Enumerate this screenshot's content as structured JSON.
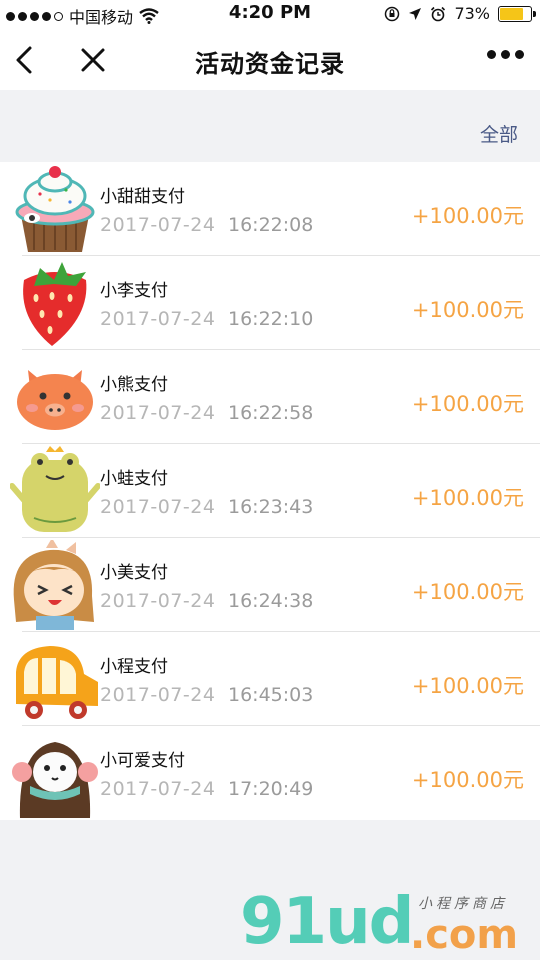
{
  "status_bar": {
    "carrier": "中国移动",
    "time": "4:20 PM",
    "battery": "73%",
    "battery_level": 0.73,
    "battery_color": "#f5c518"
  },
  "nav": {
    "title": "活动资金记录",
    "back_icon": "chevron-left-icon",
    "close_icon": "close-icon",
    "more_icon": "more-dots-icon"
  },
  "filter": {
    "label": "全部"
  },
  "records": [
    {
      "name": "小甜甜支付",
      "date": "2017-07-24",
      "time": "16:22:08",
      "amount": "+100.00元",
      "avatar": "cupcake-icon"
    },
    {
      "name": "小李支付",
      "date": "2017-07-24",
      "time": "16:22:10",
      "amount": "+100.00元",
      "avatar": "strawberry-icon"
    },
    {
      "name": "小熊支付",
      "date": "2017-07-24",
      "time": "16:22:58",
      "amount": "+100.00元",
      "avatar": "pig-icon"
    },
    {
      "name": "小蛙支付",
      "date": "2017-07-24",
      "time": "16:23:43",
      "amount": "+100.00元",
      "avatar": "frog-icon"
    },
    {
      "name": "小美支付",
      "date": "2017-07-24",
      "time": "16:24:38",
      "amount": "+100.00元",
      "avatar": "girl-icon"
    },
    {
      "name": "小程支付",
      "date": "2017-07-24",
      "time": "16:45:03",
      "amount": "+100.00元",
      "avatar": "bus-icon"
    },
    {
      "name": "小可爱支付",
      "date": "2017-07-24",
      "time": "17:20:49",
      "amount": "+100.00元",
      "avatar": "monkey-icon"
    }
  ],
  "colors": {
    "amount": "#f5a444",
    "filter": "#4a5a86",
    "date": "#b6b6b6"
  },
  "watermark": {
    "main": "91ud",
    "suffix": ".com",
    "sub": "小程序商店"
  }
}
